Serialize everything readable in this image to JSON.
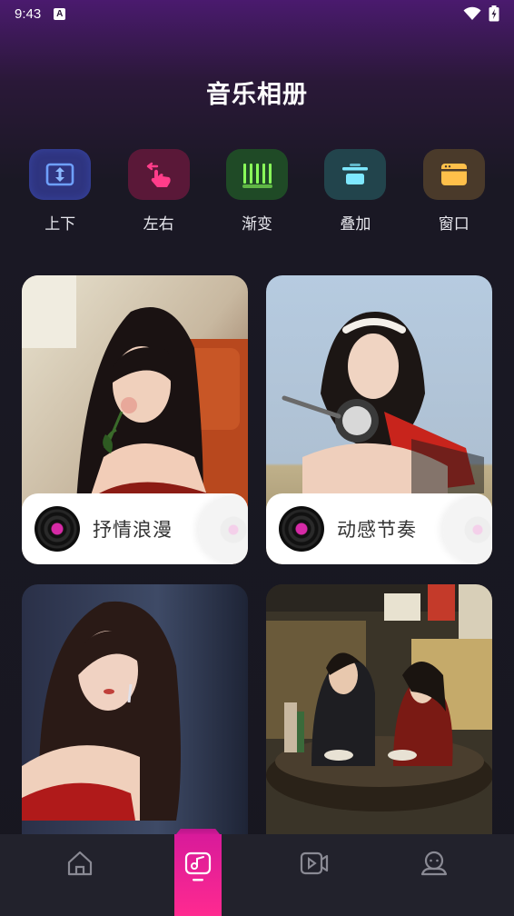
{
  "status_bar": {
    "time": "9:43",
    "notification_letter": "A"
  },
  "page": {
    "title": "音乐相册"
  },
  "categories": [
    {
      "label": "上下",
      "icon": "up-down-icon",
      "tile_color": "#2f3580",
      "glyph_color": "#6ea0ff"
    },
    {
      "label": "左右",
      "icon": "swipe-hand-icon",
      "tile_color": "#5a1838",
      "glyph_color": "#ff3d8a"
    },
    {
      "label": "渐变",
      "icon": "gradient-bars-icon",
      "tile_color": "#1f4a26",
      "glyph_color": "#8aff5a"
    },
    {
      "label": "叠加",
      "icon": "overlay-icon",
      "tile_color": "#22444c",
      "glyph_color": "#7ee8ff"
    },
    {
      "label": "窗口",
      "icon": "window-icon",
      "tile_color": "#4a3a2a",
      "glyph_color": "#ffc04a"
    }
  ],
  "cards": [
    {
      "label": "抒情浪漫",
      "photo": "woman-red-dress-rose-photo"
    },
    {
      "label": "动感节奏",
      "photo": "woman-scooter-photo"
    },
    {
      "label": "",
      "photo": "woman-red-dress-earrings-photo"
    },
    {
      "label": "",
      "photo": "couple-eating-noodles-photo"
    }
  ],
  "bottom_nav": [
    {
      "name": "home",
      "icon": "home-icon",
      "active": false
    },
    {
      "name": "album",
      "icon": "music-album-icon",
      "active": true
    },
    {
      "name": "video",
      "icon": "video-icon",
      "active": false
    },
    {
      "name": "profile",
      "icon": "profile-icon",
      "active": false
    }
  ],
  "colors": {
    "accent": "#ff2a90",
    "background": "#171720"
  }
}
